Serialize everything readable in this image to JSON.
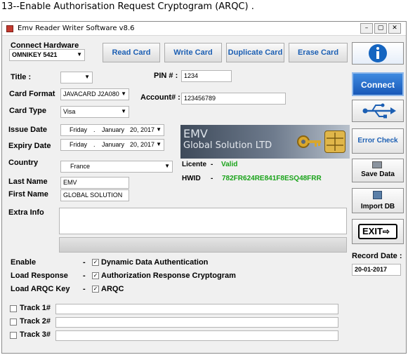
{
  "caption": "13--Enable Authorisation Request Cryptogram (ARQC) .",
  "window": {
    "title": "Emv Reader Writer Software v8.6"
  },
  "hardware": {
    "label": "Connect Hardware",
    "value": "OMNIKEY 5421"
  },
  "toolbar": {
    "read": "Read Card",
    "write": "Write Card",
    "duplicate": "Duplicate Card",
    "erase": "Erase Card"
  },
  "form": {
    "title_label": "Title :",
    "title_value": "",
    "pin_label": "PIN # :",
    "pin_value": "1234",
    "card_format_label": "Card Format",
    "card_format_value": "JAVACARD J2A080",
    "account_label": "Account# :",
    "account_value": "123456789",
    "card_type_label": "Card Type",
    "card_type_value": "Visa",
    "issue_label": "Issue Date",
    "issue_date": {
      "weekday": "Friday",
      "month": "January",
      "day": "20, 2017"
    },
    "expiry_label": "Expiry Date",
    "expiry_date": {
      "weekday": "Friday",
      "month": "January",
      "day": "20, 2017"
    },
    "country_label": "Country",
    "country_value": "France",
    "last_name_label": "Last Name",
    "last_name_value": "EMV",
    "first_name_label": "First Name",
    "first_name_value": "GLOBAL SOLUTION",
    "extra_label": "Extra Info",
    "extra_value": ""
  },
  "banner": {
    "line1": "EMV",
    "line2": "Global Solution LTD"
  },
  "license": {
    "label": "Licente",
    "dash": "-",
    "value": "Valid",
    "hwid_label": "HWID",
    "hwid_value": "782FR624RE841F8ESQ48FRR"
  },
  "options": [
    {
      "label": "Enable",
      "dash": "-",
      "text": "Dynamic Data Authentication",
      "checked": "✓"
    },
    {
      "label": "Load Response",
      "dash": "-",
      "text": "Authorization Response Cryptogram",
      "checked": "✓"
    },
    {
      "label": "Load ARQC Key",
      "dash": "-",
      "text": "ARQC",
      "checked": "✓"
    }
  ],
  "tracks": [
    {
      "label": "Track 1#",
      "value": ""
    },
    {
      "label": "Track 2#",
      "value": ""
    },
    {
      "label": "Track 3#",
      "value": ""
    }
  ],
  "side": {
    "connect": "Connect",
    "error_check": "Error Check",
    "save_data": "Save Data",
    "import_db": "Import DB",
    "exit": "EXIT",
    "record_label": "Record Date :",
    "record_value": "20-01-2017"
  },
  "colors": {
    "accent_blue": "#1c5fb3",
    "valid_green": "#19a319",
    "info_blue": "#1565c0"
  }
}
